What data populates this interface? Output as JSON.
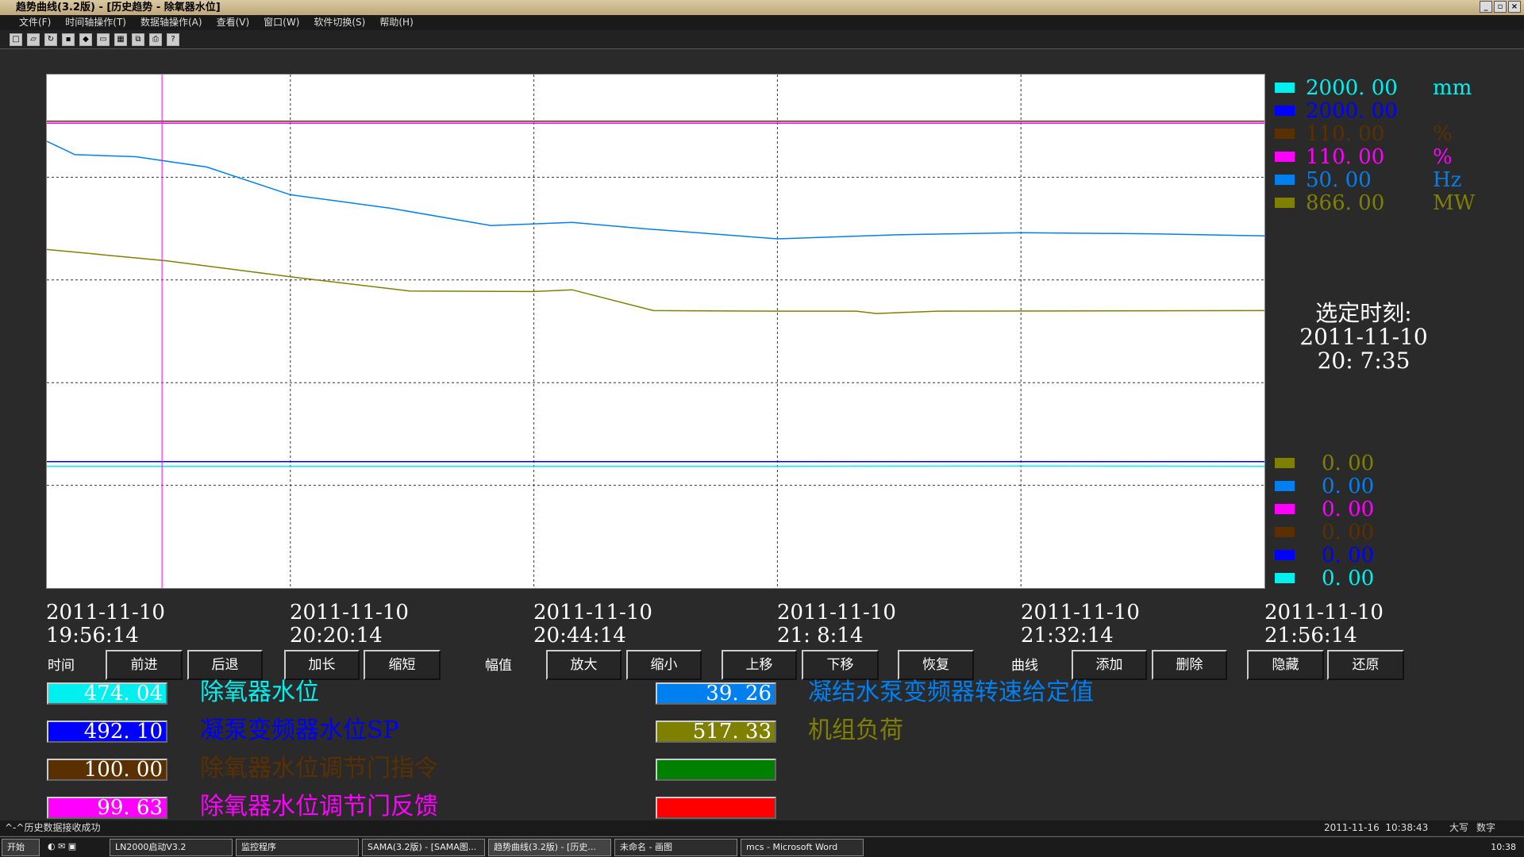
{
  "window": {
    "title": "趋势曲线(3.2版) - [历史趋势 - 除氧器水位]"
  },
  "menu": [
    "文件(F)",
    "时间轴操作(T)",
    "数据轴操作(A)",
    "查看(V)",
    "窗口(W)",
    "软件切换(S)",
    "帮助(H)"
  ],
  "toolbar_icons": [
    "new-icon",
    "open-icon",
    "reload-icon",
    "save-icon",
    "cube-icon",
    "window-icon",
    "image-icon",
    "restore-icon",
    "print-icon",
    "help-icon"
  ],
  "legend_top": [
    {
      "color": "#00f0f0",
      "value": "2000. 00",
      "unit": "mm"
    },
    {
      "color": "#0000ff",
      "value": "2000. 00",
      "unit": ""
    },
    {
      "color": "#5a3000",
      "value": "110. 00",
      "unit": "%"
    },
    {
      "color": "#ff00ff",
      "value": "110. 00",
      "unit": "%"
    },
    {
      "color": "#0080f0",
      "value": "50. 00",
      "unit": "Hz"
    },
    {
      "color": "#808000",
      "value": "866. 00",
      "unit": "MW"
    }
  ],
  "legend_bottom": [
    {
      "color": "#808000",
      "value": "0. 00"
    },
    {
      "color": "#0080f0",
      "value": "0. 00"
    },
    {
      "color": "#ff00ff",
      "value": "0. 00"
    },
    {
      "color": "#5a3000",
      "value": "0. 00"
    },
    {
      "color": "#0000ff",
      "value": "0. 00"
    },
    {
      "color": "#00f0f0",
      "value": "0. 00"
    }
  ],
  "selected_time": {
    "label": "选定时刻:",
    "date": "2011-11-10",
    "time": "20: 7:35"
  },
  "x_ticks": [
    {
      "date": "2011-11-10",
      "time": "19:56:14"
    },
    {
      "date": "2011-11-10",
      "time": "20:20:14"
    },
    {
      "date": "2011-11-10",
      "time": "20:44:14"
    },
    {
      "date": "2011-11-10",
      "time": "21: 8:14"
    },
    {
      "date": "2011-11-10",
      "time": "21:32:14"
    },
    {
      "date": "2011-11-10",
      "time": "21:56:14"
    }
  ],
  "controls": {
    "time_label": "时间",
    "amp_label": "幅值",
    "curve_label": "曲线",
    "buttons": [
      "前进",
      "后退",
      "加长",
      "缩短",
      "放大",
      "缩小",
      "上移",
      "下移",
      "恢复",
      "添加",
      "删除",
      "隐藏",
      "还原"
    ]
  },
  "series_left": [
    {
      "color": "#00f0f0",
      "value": "474. 04",
      "name": "除氧器水位"
    },
    {
      "color": "#0000ff",
      "value": "492. 10",
      "name": "凝泵变频器水位SP"
    },
    {
      "color": "#5a3000",
      "value": "100. 00",
      "name": "除氧器水位调节门指令"
    },
    {
      "color": "#ff00ff",
      "value": "99. 63",
      "name": "除氧器水位调节门反馈"
    }
  ],
  "series_right": [
    {
      "color": "#0080f0",
      "value": "39. 26",
      "name": "凝结水泵变频器转速给定值"
    },
    {
      "color": "#808000",
      "value": "517. 33",
      "name": "机组负荷"
    },
    {
      "color": "#008000",
      "value": "",
      "name": ""
    },
    {
      "color": "#ff0000",
      "value": "",
      "name": ""
    }
  ],
  "chart_data": {
    "type": "line",
    "x_range": [
      "2011-11-10 19:56:14",
      "2011-11-10 21:56:14"
    ],
    "cursor_time": "2011-11-10 20:07:35",
    "grid": true,
    "series": [
      {
        "name": "除氧器水位",
        "color": "#00f0f0",
        "max": 2000,
        "unit": "mm",
        "x": [
          "19:56:14",
          "20:20:14",
          "20:44:14",
          "21:08:14",
          "21:32:14",
          "21:56:14"
        ],
        "values": [
          474,
          474,
          474,
          474,
          475,
          474
        ]
      },
      {
        "name": "凝泵变频器水位SP",
        "color": "#0000ff",
        "max": 2000,
        "x": [
          "19:56:14",
          "21:56:14"
        ],
        "values": [
          492,
          492
        ]
      },
      {
        "name": "除氧器水位调节门指令",
        "color": "#5a3000",
        "max": 110,
        "unit": "%",
        "x": [
          "19:56:14",
          "21:56:14"
        ],
        "values": [
          100,
          100
        ]
      },
      {
        "name": "除氧器水位调节门反馈",
        "color": "#ff00ff",
        "max": 110,
        "unit": "%",
        "x": [
          "19:56:14",
          "21:56:14"
        ],
        "values": [
          99.6,
          99.6
        ]
      },
      {
        "name": "凝结水泵变频器转速给定值",
        "color": "#0080f0",
        "max": 50,
        "unit": "Hz",
        "x": [
          "19:56:14",
          "19:59:00",
          "20:05:00",
          "20:12:00",
          "20:20:14",
          "20:30:00",
          "20:40:00",
          "20:48:00",
          "20:55:00",
          "21:03:00",
          "21:08:14",
          "21:20:00",
          "21:32:14",
          "21:45:00",
          "21:56:14"
        ],
        "values": [
          43.5,
          42.2,
          42,
          41,
          38.3,
          37,
          35.3,
          35.6,
          35,
          34.4,
          34,
          34.4,
          34.6,
          34.5,
          34.3
        ]
      },
      {
        "name": "机组负荷",
        "color": "#808000",
        "max": 866,
        "unit": "MW",
        "x": [
          "19:56:14",
          "20:08:00",
          "20:20:14",
          "20:32:00",
          "20:44:14",
          "20:48:00",
          "20:56:00",
          "21:08:14",
          "21:16:00",
          "21:18:00",
          "21:24:00",
          "21:56:14"
        ],
        "values": [
          571,
          552,
          525,
          501,
          500,
          503,
          468,
          467,
          467,
          463,
          467,
          468
        ]
      }
    ]
  },
  "status": {
    "message": "^-^历史数据接收成功",
    "datetime": "2011-11-16  10:38:43",
    "caps": "大写",
    "num": "数字"
  },
  "taskbar": {
    "start": "开始",
    "tasks": [
      "LN2000启动V3.2",
      "监控程序",
      "SAMA(3.2版) - [SAMA图...",
      "趋势曲线(3.2版) - [历史...",
      "未命名 - 画图",
      "mcs - Microsoft Word"
    ],
    "clock": "10:38"
  }
}
